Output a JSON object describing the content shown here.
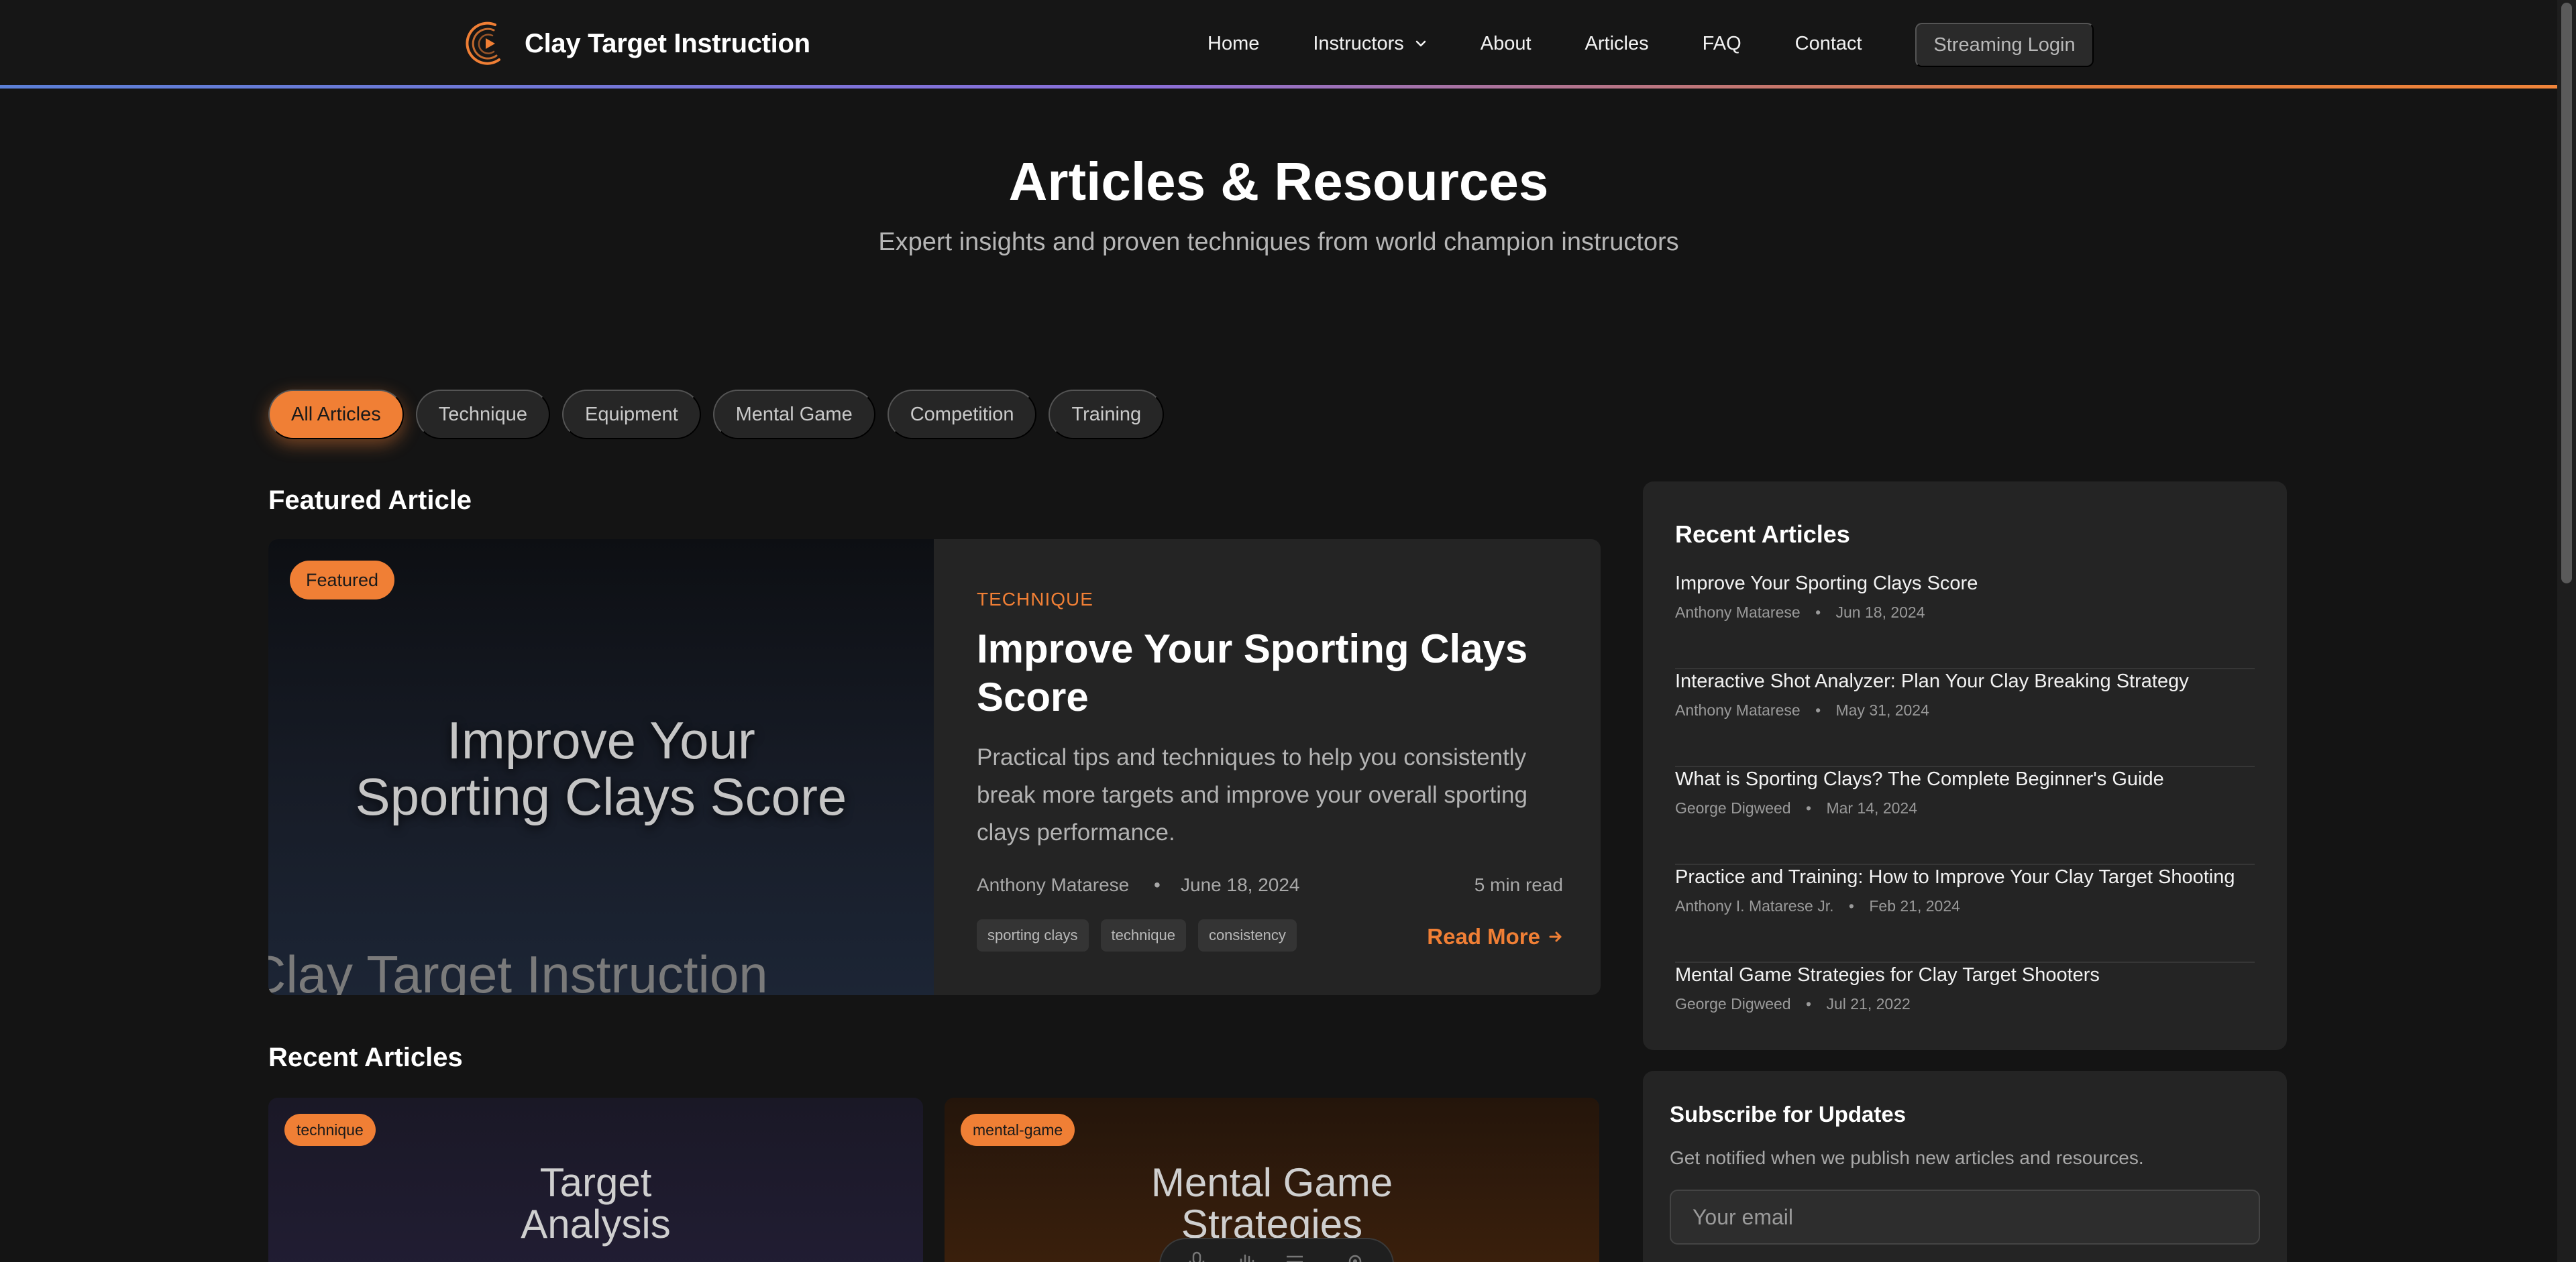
{
  "brand": {
    "title": "Clay Target Instruction"
  },
  "nav": {
    "items": [
      {
        "label": "Home"
      },
      {
        "label": "Instructors",
        "has_dropdown": true
      },
      {
        "label": "About"
      },
      {
        "label": "Articles"
      },
      {
        "label": "FAQ"
      },
      {
        "label": "Contact"
      }
    ],
    "streaming_login": "Streaming Login"
  },
  "hero": {
    "title": "Articles & Resources",
    "subtitle": "Expert insights and proven techniques from world champion instructors"
  },
  "filters": {
    "items": [
      {
        "label": "All Articles",
        "active": true
      },
      {
        "label": "Technique"
      },
      {
        "label": "Equipment"
      },
      {
        "label": "Mental Game"
      },
      {
        "label": "Competition"
      },
      {
        "label": "Training"
      }
    ]
  },
  "featured": {
    "section_title": "Featured Article",
    "badge": "Featured",
    "image_text_line1": "Improve Your",
    "image_text_line2": "Sporting Clays Score",
    "image_watermark": "Clay Target Instruction",
    "category": "TECHNIQUE",
    "title": "Improve Your Sporting Clays Score",
    "description": "Practical tips and techniques to help you consistently break more targets and improve your overall sporting clays performance.",
    "author": "Anthony Matarese",
    "separator": "•",
    "date": "June 18, 2024",
    "read_time": "5 min read",
    "tags": [
      "sporting clays",
      "technique",
      "consistency"
    ],
    "read_more": "Read More"
  },
  "recent": {
    "section_title": "Recent Articles",
    "cards": [
      {
        "badge": "technique",
        "image_line1": "Target",
        "image_line2": "Analysis"
      },
      {
        "badge": "mental-game",
        "image_line1": "Mental Game",
        "image_line2": "Strategies"
      }
    ]
  },
  "sidebar": {
    "title": "Recent Articles",
    "items": [
      {
        "title": "Improve Your Sporting Clays Score",
        "author": "Anthony Matarese",
        "date": "Jun 18, 2024"
      },
      {
        "title": "Interactive Shot Analyzer: Plan Your Clay Breaking Strategy",
        "author": "Anthony Matarese",
        "date": "May 31, 2024"
      },
      {
        "title": "What is Sporting Clays? The Complete Beginner's Guide",
        "author": "George Digweed",
        "date": "Mar 14, 2024"
      },
      {
        "title": "Practice and Training: How to Improve Your Clay Target Shooting",
        "author": "Anthony I. Matarese Jr.",
        "date": "Feb 21, 2024"
      },
      {
        "title": "Mental Game Strategies for Clay Target Shooters",
        "author": "George Digweed",
        "date": "Jul 21, 2022"
      }
    ],
    "separator": "•"
  },
  "subscribe": {
    "title": "Subscribe for Updates",
    "description": "Get notified when we publish new articles and resources.",
    "placeholder": "Your email"
  },
  "colors": {
    "accent": "#f07f35",
    "background": "#141414",
    "card": "#242424"
  }
}
